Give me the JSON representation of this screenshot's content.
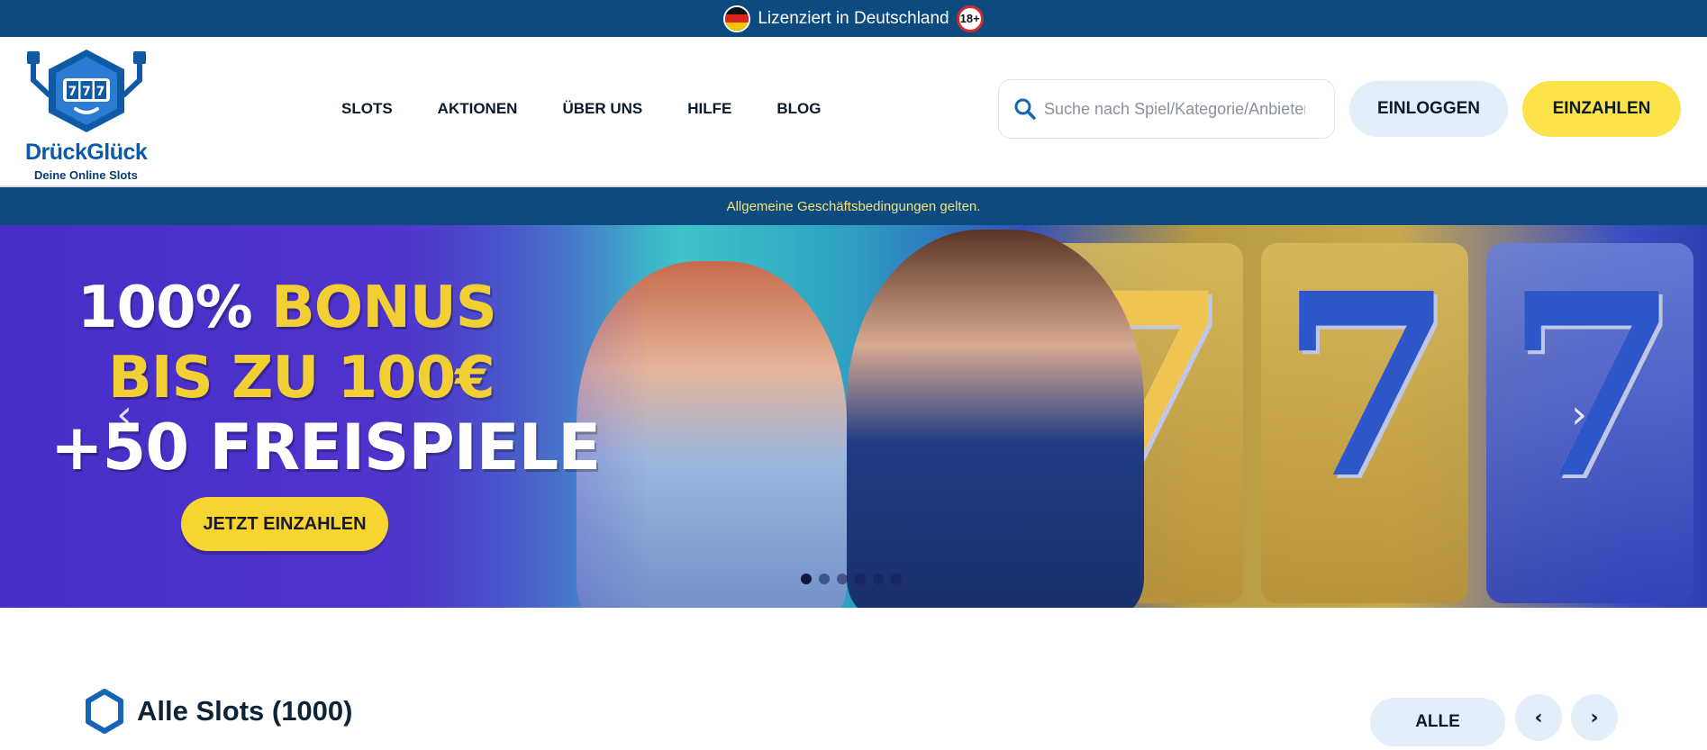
{
  "license_bar": {
    "text": "Lizenziert in Deutschland",
    "age_badge": "18+",
    "flag_icon": "germany-flag-icon"
  },
  "header": {
    "logo": {
      "name": "DrückGlück",
      "tagline": "Deine Online Slots",
      "reel_text": "777"
    },
    "nav": [
      {
        "label": "SLOTS"
      },
      {
        "label": "AKTIONEN"
      },
      {
        "label": "ÜBER UNS"
      },
      {
        "label": "HILFE"
      },
      {
        "label": "BLOG"
      }
    ],
    "search": {
      "placeholder": "Suche nach Spiel/Kategorie/Anbieter",
      "icon": "search-icon"
    },
    "login_label": "EINLOGGEN",
    "deposit_label": "EINZAHLEN"
  },
  "terms_bar": {
    "text": "Allgemeine Geschäftsbedingungen gelten."
  },
  "hero": {
    "line1_prefix": "100% ",
    "line1_highlight": "BONUS",
    "line2": "BIS ZU 100€",
    "line3": "+50 FREISPIELE",
    "cta_label": "JETZT EINZAHLEN",
    "slide_count": 6,
    "active_slide": 1,
    "colors": {
      "highlight": "#f2cf32",
      "cta": "#f7d530"
    }
  },
  "slots_section": {
    "title": "Alle Slots (1000)",
    "filter_label": "ALLE",
    "prev_icon": "chevron-left-icon",
    "next_icon": "chevron-right-icon"
  },
  "colors": {
    "brand_navy": "#0c4a80",
    "accent_yellow": "#fde34a",
    "light_blue": "#e3eefb"
  }
}
